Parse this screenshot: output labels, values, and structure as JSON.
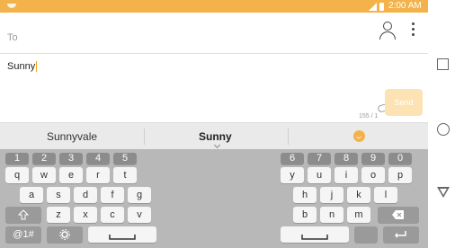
{
  "status": {
    "time": "2:00 AM"
  },
  "compose": {
    "to_label": "To",
    "message": "Sunny",
    "counter": "155 / 1",
    "send_label": "Send"
  },
  "suggestions": {
    "left": "Sunnyvale",
    "middle": "Sunny"
  },
  "keyboard": {
    "numbers_left": [
      "1",
      "2",
      "3",
      "4",
      "5"
    ],
    "numbers_right": [
      "6",
      "7",
      "8",
      "9",
      "0"
    ],
    "row1_left": [
      "q",
      "w",
      "e",
      "r",
      "t"
    ],
    "row1_right": [
      "y",
      "u",
      "i",
      "o",
      "p"
    ],
    "row2_left": [
      "a",
      "s",
      "d",
      "f",
      "g"
    ],
    "row2_right": [
      "h",
      "j",
      "k",
      "l"
    ],
    "row3_left": [
      "z",
      "x",
      "c",
      "v"
    ],
    "row3_right": [
      "b",
      "n",
      "m"
    ],
    "symbols_label": "@1#"
  },
  "colors": {
    "accent": "#f4b24a",
    "keyboard_bg": "#b8b8b8"
  },
  "icons": [
    "contact-icon",
    "more-options-icon",
    "attachment-icon",
    "emoji-icon",
    "shift-icon",
    "backspace-icon",
    "enter-icon",
    "settings-icon"
  ]
}
